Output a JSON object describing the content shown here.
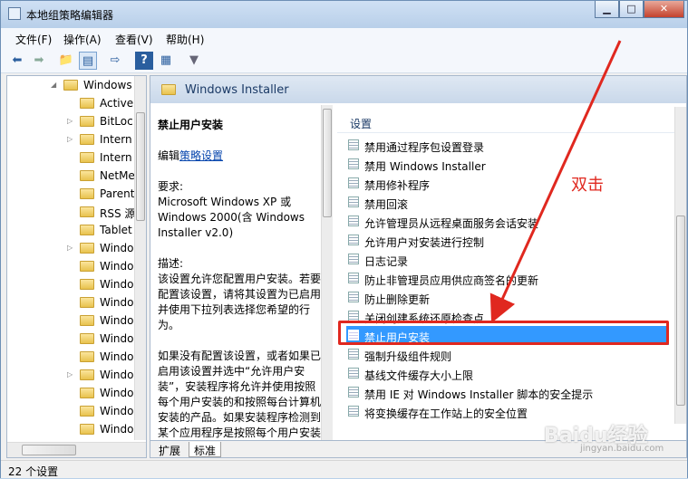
{
  "window": {
    "title": "本地组策略编辑器",
    "minimize": "▁",
    "maximize": "□",
    "close": "✕"
  },
  "menu": [
    "文件(F)",
    "操作(A)",
    "查看(V)",
    "帮助(H)"
  ],
  "tree": {
    "items": [
      {
        "label": "Windows",
        "expanded": true
      },
      {
        "label": "Active"
      },
      {
        "label": "BitLoc"
      },
      {
        "label": "Intern"
      },
      {
        "label": "Intern"
      },
      {
        "label": "NetMe"
      },
      {
        "label": "Parent"
      },
      {
        "label": "RSS 源"
      },
      {
        "label": "Tablet"
      },
      {
        "label": "Windo"
      },
      {
        "label": "Windo"
      },
      {
        "label": "Windo"
      },
      {
        "label": "Windo"
      },
      {
        "label": "Windo"
      },
      {
        "label": "Windo"
      },
      {
        "label": "Windo"
      },
      {
        "label": "Windo"
      },
      {
        "label": "Windo"
      },
      {
        "label": "Windo"
      },
      {
        "label": "Windo"
      }
    ]
  },
  "header": {
    "title": "Windows Installer"
  },
  "desc": {
    "heading": "禁止用户安装",
    "edit_prefix": "编辑",
    "edit_link": "策略设置",
    "req_label": "要求:",
    "req_text": "Microsoft Windows XP 或 Windows 2000(含 Windows Installer v2.0)",
    "desc_label": "描述:",
    "desc_text": "该设置允许您配置用户安装。若要配置该设置，请将其设置为已启用并使用下拉列表选择您希望的行为。",
    "desc_text2": "如果没有配置该设置，或者如果已启用该设置并选中“允许用户安装”，安装程序将允许并使用按照每个用户安装的和按照每台计算机安装的产品。如果安装程序检测到某个应用程序是按照每个用户安装"
  },
  "list": {
    "column": "设置",
    "items": [
      "禁用通过程序包设置登录",
      "禁用 Windows Installer",
      "禁用修补程序",
      "禁用回滚",
      "允许管理员从远程桌面服务会话安装",
      "允许用户对安装进行控制",
      "日志记录",
      "防止非管理员应用供应商签名的更新",
      "防止删除更新",
      "关闭创建系统还原检查点",
      "禁止用户安装",
      "强制升级组件规则",
      "基线文件缓存大小上限",
      "禁用 IE 对 Windows Installer 脚本的安全提示",
      "将变换缓存在工作站上的安全位置"
    ],
    "selected_index": 10
  },
  "tabs": [
    "扩展",
    "标准"
  ],
  "status": "22 个设置",
  "annotation": "双击",
  "watermark": "Baidu经验",
  "watermark_url": "jingyan.baidu.com",
  "colors": {
    "selection": "#3399ff",
    "annotation": "#e0281f"
  }
}
